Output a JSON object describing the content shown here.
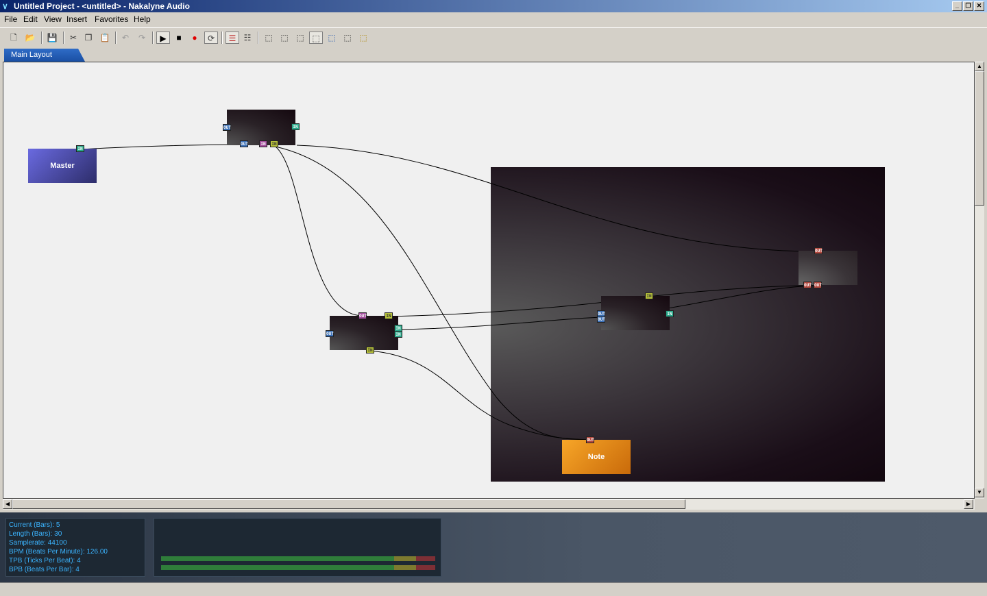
{
  "window": {
    "title": "Untitled Project - <untitled> - Nakalyne Audio"
  },
  "menu": [
    "File",
    "Edit",
    "View",
    "Insert",
    "Favorites",
    "Help"
  ],
  "toolbar": {
    "icons": [
      "new-icon",
      "open-icon",
      "save-icon",
      "cut-icon",
      "copy-icon",
      "paste-icon",
      "undo-icon",
      "redo-icon",
      "play-icon",
      "stop-icon",
      "record-icon",
      "loop-icon",
      "mixer-icon",
      "plugins-icon",
      "view1-icon",
      "view2-icon",
      "view3-icon",
      "view4-icon",
      "view5-icon",
      "view6-icon",
      "view7-icon"
    ]
  },
  "tabs": [
    {
      "label": "Main Layout",
      "active": true
    }
  ],
  "nodes": {
    "master": {
      "label": "Master",
      "color": "#5a5ad0"
    },
    "note": {
      "label": "Note",
      "color": "#f29a1e"
    }
  },
  "info": {
    "current": "Current (Bars): 5",
    "length": "Length (Bars): 30",
    "samplerate": "Samplerate: 44100",
    "bpm": "BPM (Beats Per Minute): 126.00",
    "tpb": "TPB (Ticks Per Beat): 4",
    "bpb": "BPB (Beats Per Bar): 4"
  },
  "meter": {
    "left_level": 0.85,
    "right_level": 0.85
  }
}
